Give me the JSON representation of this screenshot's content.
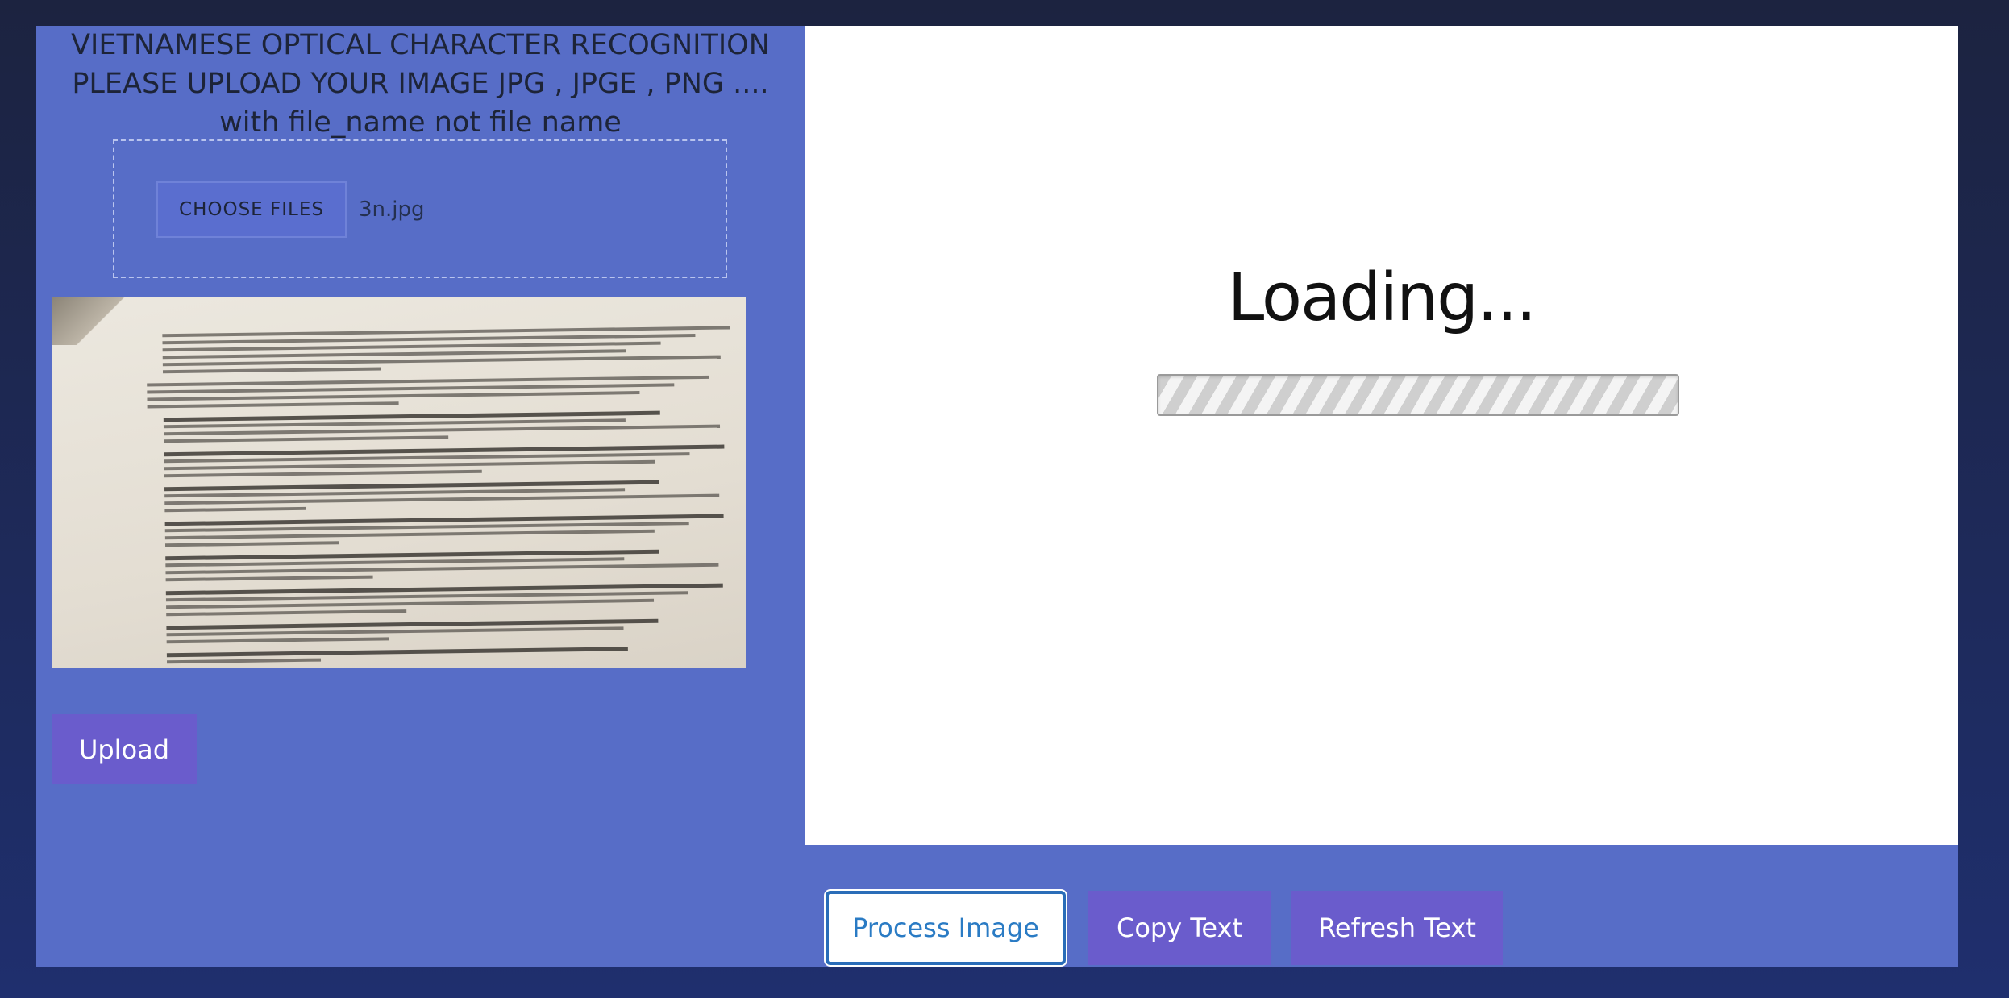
{
  "header": {
    "title_line1": "VIETNAMESE OPTICAL CHARACTER RECOGNITION",
    "title_line2": "PLEASE UPLOAD YOUR IMAGE JPG , JPGE , PNG ....",
    "title_line3": "with file_name not file name"
  },
  "upload": {
    "choose_label": "CHOOSE FILES",
    "file_name": "3n.jpg",
    "upload_label": "Upload"
  },
  "status": {
    "loading_text": "Loading..."
  },
  "actions": {
    "process_label": "Process Image",
    "copy_label": "Copy Text",
    "refresh_label": "Refresh Text"
  },
  "colors": {
    "panel_bg": "#576dc7",
    "button_purple": "#6a5ccc",
    "accent_blue": "#2a7bc4"
  }
}
